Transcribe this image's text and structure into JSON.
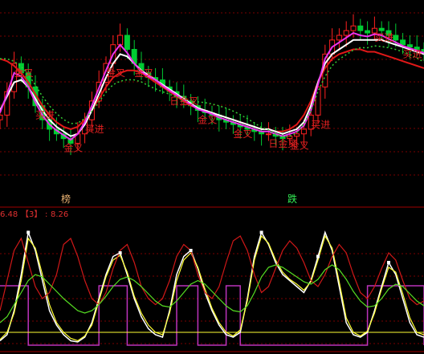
{
  "panel_badges": [
    {
      "text": "榜",
      "color": "#e8b070"
    },
    {
      "text": "跌",
      "color": "#33ee55"
    }
  ],
  "indicator_readout": [
    {
      "text": "6.48",
      "color": "#e03030"
    },
    {
      "text": "【3】",
      "color": "#e03030"
    },
    {
      "text": ":",
      "color": "#e03030"
    },
    {
      "text": "8.26",
      "color": "#e03030"
    }
  ],
  "signal_labels": [
    {
      "text": "金叉",
      "color": "#e02020"
    },
    {
      "text": "买进",
      "color": "#e02020"
    },
    {
      "text": "日金叉",
      "color": "#e02020"
    }
  ],
  "colors": {
    "background": "#000000",
    "grid": "#7a0000",
    "separator": "#a00000",
    "up_candle": "#ff2020",
    "down_candle": "#00cc33",
    "ma_white": "#ffffff",
    "ma_red": "#e01818",
    "ma_magenta": "#ee33ee",
    "ma_green_dotted": "#33cc33",
    "kdj_white": "#ffffff",
    "kdj_yellow": "#ffff33",
    "kdj_red": "#d01818",
    "kdj_green": "#55dd22",
    "step_magenta": "#bb33bb"
  },
  "chart_data": [
    {
      "type": "candlestick",
      "title": "",
      "series": [
        {
          "kind": "close",
          "values": [
            48,
            58,
            70,
            66,
            60,
            52,
            46,
            42,
            40,
            38,
            36,
            40,
            46,
            54,
            62,
            70,
            78,
            82,
            76,
            70,
            66,
            64,
            63,
            60,
            58,
            56,
            54,
            52,
            50,
            49,
            48,
            46,
            45,
            44,
            43,
            42,
            41,
            40,
            40,
            39,
            38,
            39,
            40,
            42,
            48,
            60,
            74,
            80,
            82,
            84,
            86,
            84,
            83,
            85,
            84,
            82,
            80,
            78,
            77,
            76,
            75
          ]
        },
        {
          "kind": "ma_white",
          "values": [
            50,
            56,
            62,
            63,
            60,
            55,
            50,
            46,
            43,
            41,
            39,
            40,
            44,
            50,
            57,
            64,
            70,
            74,
            73,
            70,
            67,
            65,
            63,
            61,
            59,
            57,
            55,
            53,
            51,
            50,
            49,
            48,
            47,
            46,
            45,
            44,
            43,
            42,
            42,
            41,
            40,
            41,
            42,
            45,
            52,
            62,
            70,
            74,
            76,
            78,
            80,
            80,
            80,
            80,
            80,
            79,
            78,
            77,
            76,
            75,
            74
          ]
        },
        {
          "kind": "ma_red",
          "values": [
            72,
            71,
            69,
            66,
            62,
            57,
            52,
            48,
            45,
            43,
            42,
            43,
            46,
            50,
            55,
            60,
            64,
            66,
            67,
            67,
            66,
            64,
            62,
            60,
            58,
            56,
            54,
            52,
            51,
            50,
            49,
            48,
            47,
            46,
            45,
            44,
            43,
            42,
            42,
            41,
            41,
            42,
            44,
            48,
            54,
            62,
            68,
            72,
            74,
            75,
            76,
            76,
            75,
            75,
            74,
            73,
            72,
            71,
            70,
            69,
            68
          ]
        }
      ]
    },
    {
      "type": "line",
      "title": "",
      "series": [
        {
          "kind": "kdj_white",
          "values": [
            5,
            10,
            30,
            60,
            95,
            80,
            55,
            30,
            18,
            10,
            5,
            4,
            8,
            20,
            40,
            60,
            75,
            78,
            60,
            40,
            25,
            15,
            10,
            8,
            30,
            60,
            75,
            80,
            65,
            45,
            30,
            18,
            10,
            8,
            12,
            40,
            75,
            95,
            85,
            70,
            60,
            55,
            50,
            45,
            55,
            75,
            95,
            80,
            50,
            20,
            10,
            8,
            12,
            30,
            50,
            70,
            60,
            40,
            20,
            10,
            8
          ]
        },
        {
          "kind": "kdj_yellow",
          "values": [
            6,
            12,
            28,
            55,
            90,
            82,
            60,
            35,
            20,
            12,
            7,
            5,
            9,
            18,
            38,
            58,
            72,
            76,
            62,
            42,
            28,
            18,
            12,
            10,
            28,
            55,
            72,
            78,
            66,
            48,
            32,
            20,
            12,
            9,
            14,
            38,
            72,
            92,
            86,
            72,
            62,
            56,
            52,
            47,
            54,
            72,
            92,
            82,
            54,
            24,
            12,
            9,
            13,
            28,
            48,
            66,
            62,
            44,
            24,
            12,
            10
          ]
        },
        {
          "kind": "kdj_red",
          "values": [
            30,
            55,
            80,
            90,
            70,
            50,
            40,
            45,
            60,
            85,
            90,
            75,
            55,
            40,
            35,
            45,
            65,
            80,
            85,
            70,
            50,
            40,
            35,
            40,
            55,
            75,
            85,
            80,
            60,
            45,
            40,
            50,
            70,
            88,
            92,
            80,
            60,
            45,
            50,
            65,
            80,
            88,
            82,
            70,
            55,
            50,
            60,
            75,
            85,
            78,
            60,
            45,
            40,
            50,
            65,
            78,
            72,
            55,
            40,
            35,
            38
          ]
        },
        {
          "kind": "kdj_green",
          "values": [
            20,
            25,
            35,
            45,
            55,
            60,
            58,
            52,
            46,
            40,
            35,
            30,
            28,
            30,
            35,
            42,
            50,
            56,
            58,
            55,
            50,
            44,
            38,
            34,
            33,
            38,
            45,
            52,
            55,
            52,
            46,
            40,
            34,
            30,
            29,
            34,
            45,
            58,
            66,
            68,
            66,
            62,
            58,
            54,
            52,
            56,
            64,
            68,
            64,
            56,
            46,
            38,
            33,
            34,
            40,
            48,
            52,
            50,
            44,
            38,
            34
          ]
        },
        {
          "kind": "step_magenta",
          "values": [
            1,
            1,
            1,
            1,
            0,
            0,
            0,
            0,
            0,
            0,
            0,
            0,
            0,
            0,
            1,
            1,
            1,
            1,
            0,
            0,
            0,
            0,
            0,
            0,
            0,
            1,
            1,
            1,
            0,
            0,
            0,
            0,
            1,
            1,
            0,
            0,
            0,
            0,
            0,
            0,
            0,
            0,
            0,
            0,
            0,
            0,
            0,
            0,
            0,
            0,
            0,
            0,
            1,
            1,
            1,
            1,
            1,
            1,
            1,
            1,
            0
          ]
        }
      ]
    }
  ]
}
